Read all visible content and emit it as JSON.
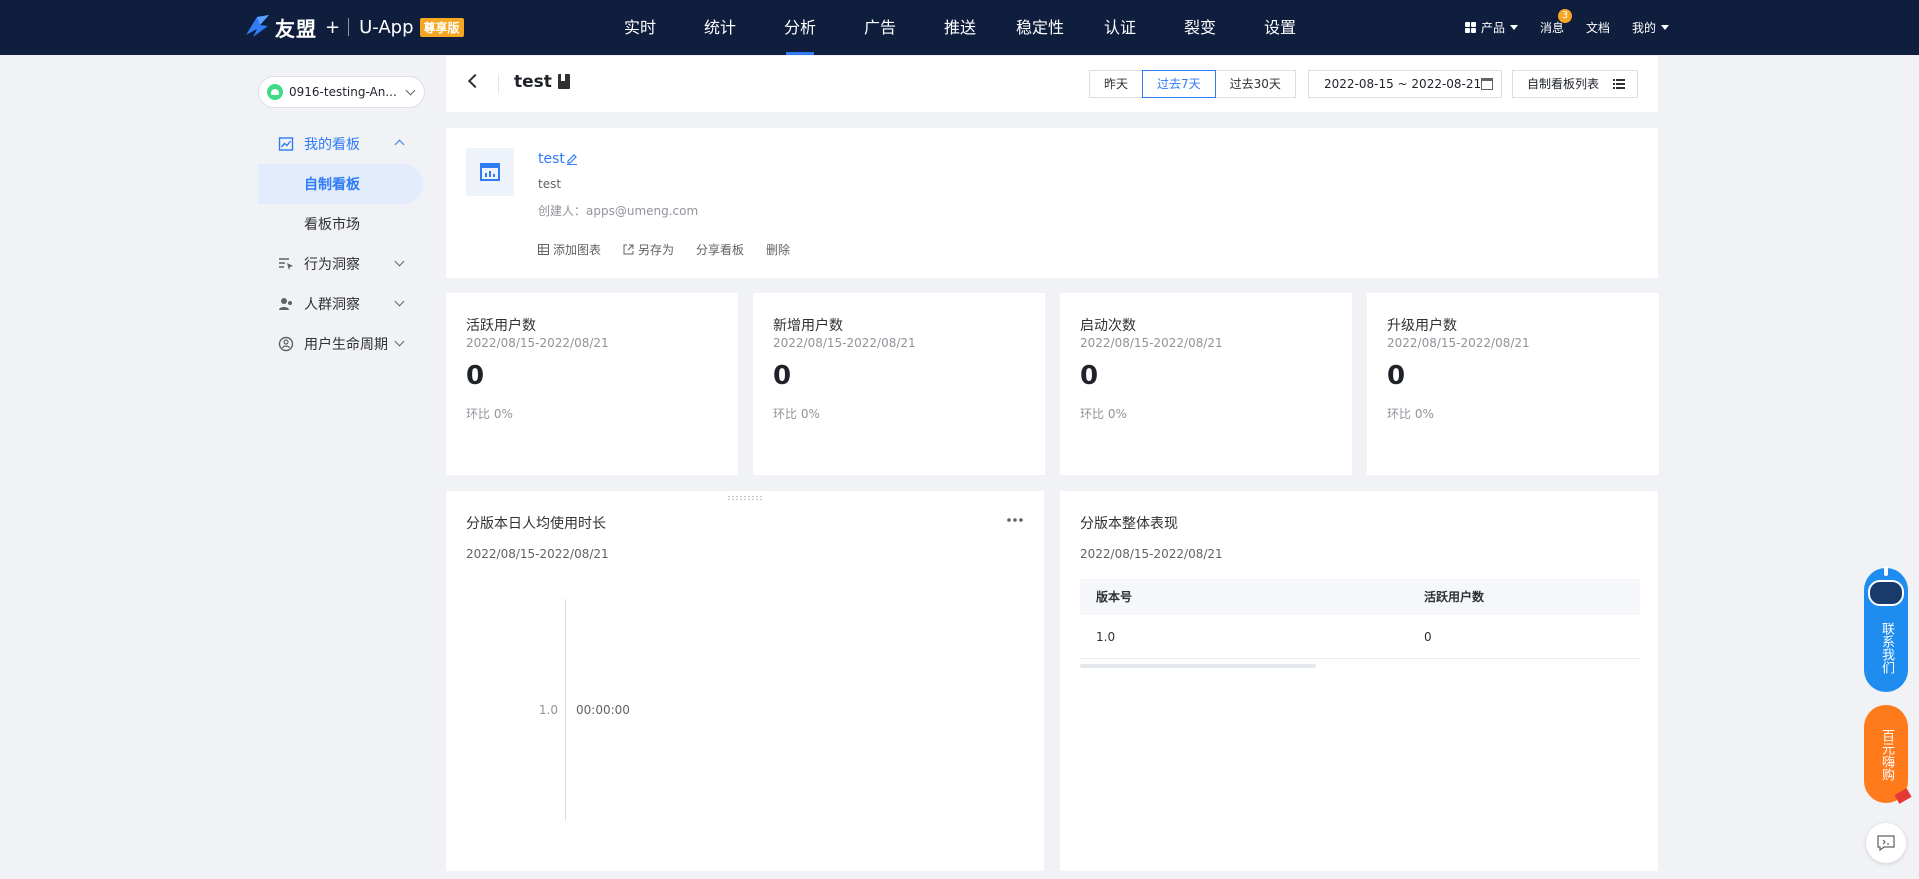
{
  "topbar": {
    "logo": {
      "brand": "友盟",
      "plus": "+",
      "product": "U-App",
      "badge": "尊享版"
    },
    "nav": [
      "实时",
      "统计",
      "分析",
      "广告",
      "推送",
      "稳定性",
      "认证",
      "裂变",
      "设置"
    ],
    "active_nav": "分析",
    "right": {
      "product_label": "产品",
      "messages_label": "消息",
      "messages_count": "3",
      "docs_label": "文档",
      "mine_label": "我的"
    }
  },
  "sidebar": {
    "app_name": "0916-testing-An...",
    "menu": {
      "my_boards": "我的看板",
      "custom_board": "自制看板",
      "board_market": "看板市场",
      "behavior_insight": "行为洞察",
      "crowd_insight": "人群洞察",
      "lifecycle": "用户生命周期"
    }
  },
  "header": {
    "title": "test",
    "ranges": [
      "昨天",
      "过去7天",
      "过去30天"
    ],
    "active_range": "过去7天",
    "date_range": "2022-08-15 ~ 2022-08-21",
    "list_button": "自制看板列表"
  },
  "board": {
    "name": "test",
    "description": "test",
    "creator": "创建人：apps@umeng.com",
    "actions": {
      "add_chart": "添加图表",
      "save_as": "另存为",
      "share": "分享看板",
      "delete": "删除"
    }
  },
  "kpis": [
    {
      "title": "活跃用户数",
      "date": "2022/08/15-2022/08/21",
      "value": "0",
      "ratio": "环比  0%"
    },
    {
      "title": "新增用户数",
      "date": "2022/08/15-2022/08/21",
      "value": "0",
      "ratio": "环比  0%"
    },
    {
      "title": "启动次数",
      "date": "2022/08/15-2022/08/21",
      "value": "0",
      "ratio": "环比  0%"
    },
    {
      "title": "升级用户数",
      "date": "2022/08/15-2022/08/21",
      "value": "0",
      "ratio": "环比  0%"
    }
  ],
  "panels": {
    "duration": {
      "title": "分版本日人均使用时长",
      "date": "2022/08/15-2022/08/21",
      "y_label": "1.0",
      "value": "00:00:00"
    },
    "versions": {
      "title": "分版本整体表现",
      "date": "2022/08/15-2022/08/21",
      "columns": [
        "版本号",
        "活跃用户数"
      ],
      "rows": [
        [
          "1.0",
          "0"
        ]
      ]
    }
  },
  "float": {
    "contact": "联系我们",
    "promo": "百元嗨购"
  },
  "colors": {
    "nav_bg": "#0f1e3d",
    "accent": "#2f7cf6",
    "badge": "#f5a623",
    "promo": "#ff7a1a"
  }
}
